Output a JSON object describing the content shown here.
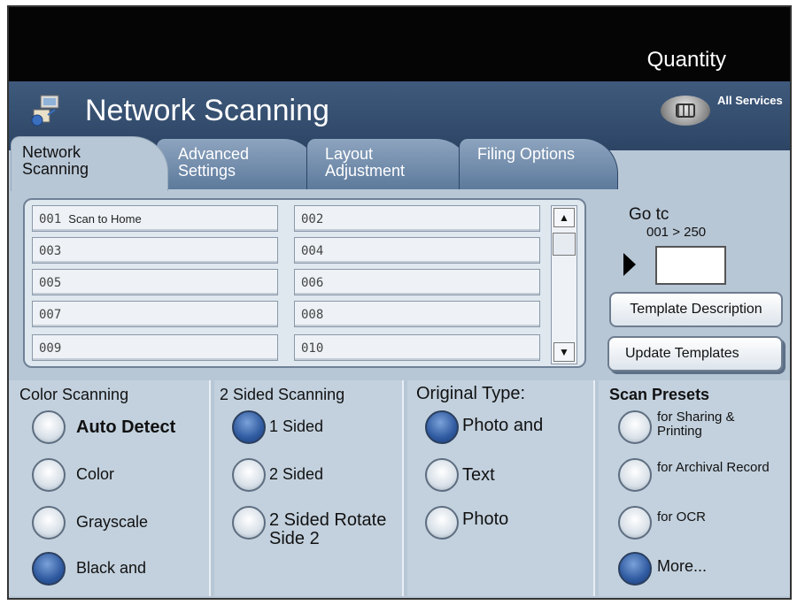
{
  "header": {
    "quantity_label": "Quantity"
  },
  "titlebar": {
    "title": "Network Scanning",
    "all_services_label": "All Services"
  },
  "tabs": [
    {
      "label": "Network Scanning",
      "active": true
    },
    {
      "label": "Advanced Settings",
      "active": false
    },
    {
      "label": "Layout Adjustment",
      "active": false
    },
    {
      "label": "Filing Options",
      "active": false
    }
  ],
  "templates": {
    "slots": [
      {
        "number": "001",
        "name": "Scan to Home"
      },
      {
        "number": "002",
        "name": ""
      },
      {
        "number": "003",
        "name": ""
      },
      {
        "number": "004",
        "name": ""
      },
      {
        "number": "005",
        "name": ""
      },
      {
        "number": "006",
        "name": ""
      },
      {
        "number": "007",
        "name": ""
      },
      {
        "number": "008",
        "name": ""
      },
      {
        "number": "009",
        "name": ""
      },
      {
        "number": "010",
        "name": ""
      }
    ],
    "scroll_up_icon": "triangle-up",
    "scroll_down_icon": "triangle-down"
  },
  "goto": {
    "title": "Go tc",
    "range": "001 > 250",
    "value": ""
  },
  "buttons": {
    "template_description": "Template Description",
    "update_templates": "Update Templates"
  },
  "color_scanning": {
    "title": "Color Scanning",
    "options": [
      {
        "label": "Auto Detect",
        "selected": false
      },
      {
        "label": "Color",
        "selected": false
      },
      {
        "label": "Grayscale",
        "selected": false
      },
      {
        "label": "Black and",
        "selected": true
      }
    ]
  },
  "sided_scanning": {
    "title": "2 Sided Scanning",
    "options": [
      {
        "label": "1 Sided",
        "selected": true
      },
      {
        "label": "2 Sided",
        "selected": false
      },
      {
        "label": "2 Sided Rotate Side 2",
        "selected": false
      }
    ]
  },
  "original_type": {
    "title": "Original Type:",
    "options": [
      {
        "label": "Photo and",
        "selected": true
      },
      {
        "label": "Text",
        "selected": false
      },
      {
        "label": "Photo",
        "selected": false
      }
    ]
  },
  "scan_presets": {
    "title": "Scan Presets",
    "options": [
      {
        "label": "for Sharing & Printing",
        "selected": false
      },
      {
        "label": "for Archival Record",
        "selected": false
      },
      {
        "label": "for OCR",
        "selected": false
      },
      {
        "label": "More...",
        "selected": true
      }
    ]
  },
  "colors": {
    "title_bar": "#3f5a7c",
    "panel": "#b8c7d6",
    "radio_selected": "#2f5aa0"
  }
}
